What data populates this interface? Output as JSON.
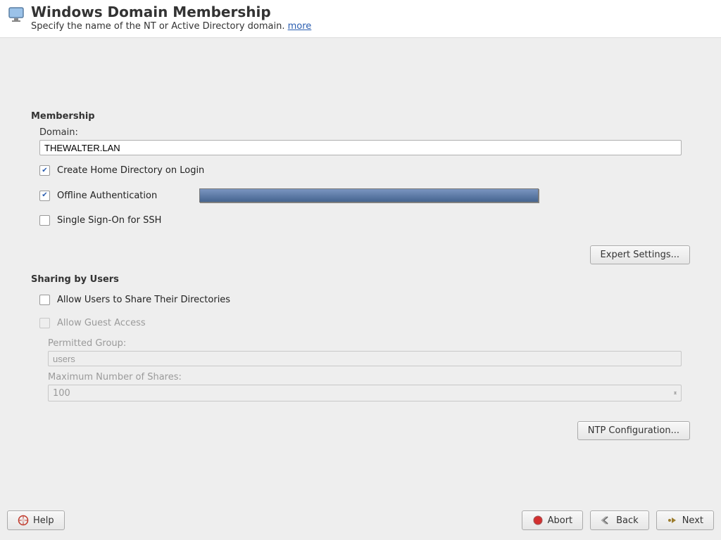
{
  "header": {
    "title": "Windows Domain Membership",
    "subtitle_prefix": "Specify the name of the NT or Active Directory domain. ",
    "more_link": "more"
  },
  "membership": {
    "section_title": "Membership",
    "domain_label": "Domain:",
    "domain_value": "THEWALTER.LAN",
    "create_home_label": "Create Home Directory on Login",
    "create_home_checked": true,
    "offline_auth_label": "Offline Authentication",
    "offline_auth_checked": true,
    "sso_ssh_label": "Single Sign-On for SSH",
    "sso_ssh_checked": false,
    "expert_button": "Expert Settings..."
  },
  "sharing": {
    "section_title": "Sharing by Users",
    "allow_share_label": "Allow Users to Share Their Directories",
    "allow_share_checked": false,
    "allow_guest_label": "Allow Guest Access",
    "allow_guest_checked": false,
    "permitted_group_label": "Permitted Group:",
    "permitted_group_value": "users",
    "max_shares_label": "Maximum Number of Shares:",
    "max_shares_value": "100",
    "ntp_button": "NTP Configuration..."
  },
  "footer": {
    "help": "Help",
    "abort": "Abort",
    "back": "Back",
    "next": "Next"
  },
  "colors": {
    "link": "#2a5db0",
    "progress_top": "#7a95c0",
    "progress_bottom": "#45648f"
  }
}
